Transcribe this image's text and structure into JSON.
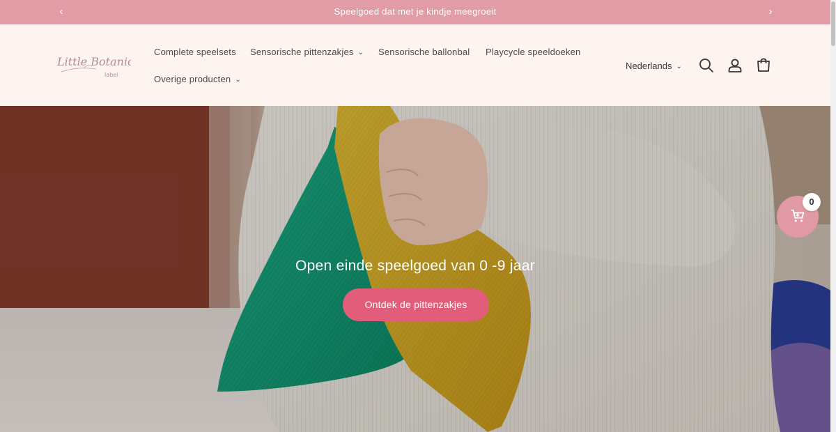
{
  "announcement": {
    "text": "Speelgoed dat met je kindje meegroeit",
    "prev_icon": "chevron-left-icon",
    "next_icon": "chevron-right-icon"
  },
  "header": {
    "logo": {
      "line1": "Little Botanic",
      "line2": "label"
    },
    "nav": [
      {
        "label": "Complete speelsets",
        "has_dropdown": false
      },
      {
        "label": "Sensorische pittenzakjes",
        "has_dropdown": true
      },
      {
        "label": "Sensorische ballonbal",
        "has_dropdown": false
      },
      {
        "label": "Playcycle speeldoeken",
        "has_dropdown": false
      },
      {
        "label": "Overige producten",
        "has_dropdown": true
      }
    ],
    "language": "Nederlands",
    "icons": [
      "search-icon",
      "account-icon",
      "cart-icon"
    ]
  },
  "hero": {
    "title": "Open einde speelgoed van 0 -9 jaar",
    "button_label": "Ontdek de pittenzakjes"
  },
  "floating_cart": {
    "count": "0",
    "icon": "shopping-cart-icon"
  },
  "colors": {
    "announcement_bg": "#e29ca5",
    "header_bg": "#fdf3ef",
    "button_bg": "#e15d79",
    "floating_cart_bg": "#e19aa5"
  }
}
